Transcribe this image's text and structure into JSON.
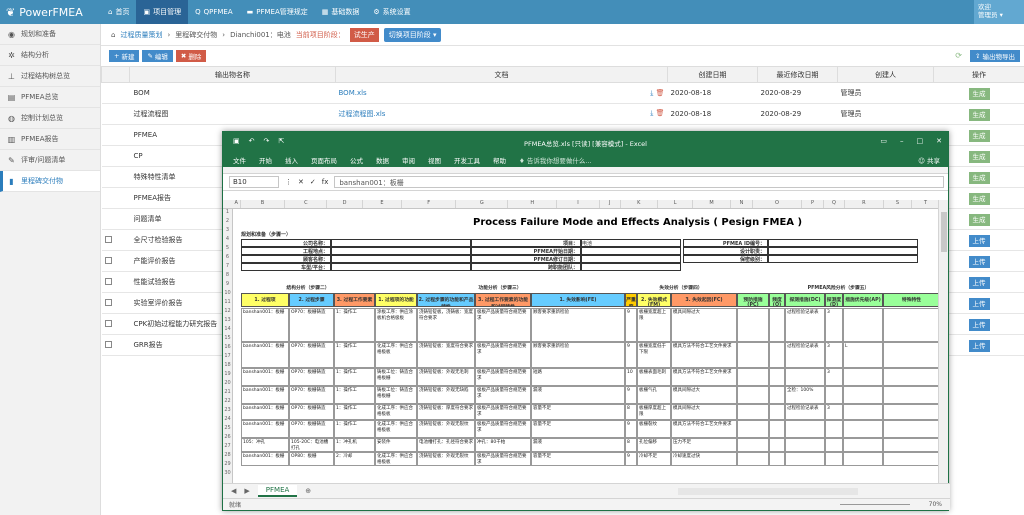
{
  "app": {
    "title": "PowerFMEA",
    "user_line1": "欢迎",
    "user_line2": "管理员"
  },
  "nav": [
    {
      "label": "首页",
      "icon": "home-icon"
    },
    {
      "label": "项目管理",
      "icon": "briefcase-icon"
    },
    {
      "label": "QPFMEA",
      "icon": "q-icon"
    },
    {
      "label": "PFMEA管理规定",
      "icon": "folder-icon"
    },
    {
      "label": "基础数据",
      "icon": "grid-icon"
    },
    {
      "label": "系统设置",
      "icon": "gear-icon"
    }
  ],
  "sidebar": [
    {
      "label": "规划和准备"
    },
    {
      "label": "结构分析"
    },
    {
      "label": "过程结构树总览"
    },
    {
      "label": "PFMEA总览"
    },
    {
      "label": "控制计划总览"
    },
    {
      "label": "PFMEA报告"
    },
    {
      "label": "评审/问题清单"
    },
    {
      "label": "里程碑交付物"
    }
  ],
  "breadcrumb": {
    "items": [
      "过程质量策划",
      "里程碑交付物",
      "Dianchi001：电池"
    ],
    "stage_label": "当前项目阶段：",
    "stage_value": "试生产",
    "switch_label": "切换项目阶段"
  },
  "toolbar": {
    "new": "新建",
    "edit": "编辑",
    "delete": "删除",
    "export": "输出物导出"
  },
  "table": {
    "headers": [
      "输出物名称",
      "文档",
      "创建日期",
      "最近修改日期",
      "创建人",
      "操作"
    ],
    "rows": [
      {
        "name": "BOM",
        "doc": "BOM.xls",
        "created": "2020-08-18",
        "modified": "2020-08-29",
        "creator": "管理员",
        "action": "生成",
        "checkbox": false
      },
      {
        "name": "过程流程图",
        "doc": "过程流程图.xls",
        "created": "2020-08-18",
        "modified": "2020-08-29",
        "creator": "管理员",
        "action": "生成",
        "checkbox": false
      },
      {
        "name": "PFMEA",
        "doc": "",
        "created": "",
        "modified": "",
        "creator": "",
        "action": "生成",
        "checkbox": false
      },
      {
        "name": "CP",
        "doc": "",
        "created": "",
        "modified": "",
        "creator": "",
        "action": "生成",
        "checkbox": false
      },
      {
        "name": "特殊特性清单",
        "doc": "",
        "created": "",
        "modified": "",
        "creator": "",
        "action": "生成",
        "checkbox": false
      },
      {
        "name": "PFMEA报告",
        "doc": "",
        "created": "",
        "modified": "",
        "creator": "",
        "action": "生成",
        "checkbox": false
      },
      {
        "name": "问题清单",
        "doc": "",
        "created": "",
        "modified": "",
        "creator": "",
        "action": "生成",
        "checkbox": false
      },
      {
        "name": "全尺寸检验报告",
        "doc": "",
        "created": "",
        "modified": "",
        "creator": "",
        "action": "上传",
        "checkbox": true
      },
      {
        "name": "产能评价报告",
        "doc": "",
        "created": "",
        "modified": "",
        "creator": "",
        "action": "上传",
        "checkbox": true
      },
      {
        "name": "性能试验报告",
        "doc": "",
        "created": "",
        "modified": "",
        "creator": "",
        "action": "上传",
        "checkbox": true
      },
      {
        "name": "实验室评价报告",
        "doc": "",
        "created": "",
        "modified": "",
        "creator": "",
        "action": "上传",
        "checkbox": true
      },
      {
        "name": "CPK初始过程能力研究报告",
        "doc": "",
        "created": "",
        "modified": "",
        "creator": "",
        "action": "上传",
        "checkbox": true
      },
      {
        "name": "GRR报告",
        "doc": "",
        "created": "",
        "modified": "",
        "creator": "",
        "action": "上传",
        "checkbox": true
      }
    ]
  },
  "excel": {
    "title": "PFMEA总览.xls  [只读]  [兼容模式] - Excel",
    "menu": [
      "文件",
      "开始",
      "插入",
      "页面布局",
      "公式",
      "数据",
      "审阅",
      "视图",
      "开发工具",
      "帮助"
    ],
    "tell": "告诉我你想要做什么...",
    "share": "共享",
    "namebox": "B10",
    "formula": "banshan001：板栅",
    "sheet_title": "Process Failure Mode and Effects Analysis ( Pesign FMEA )",
    "plan_label": "规划和准备（步骤一）",
    "form_labels": [
      "公司名称：",
      "工程地点：",
      "顾客名称：",
      "车型/平台：",
      "项目：",
      "PFMEA开始日期：",
      "PFMEA修订日期：",
      "跨职能团队：",
      "PFMEA ID编号：",
      "设计职责：",
      "保密级别："
    ],
    "form_values": [
      "电池"
    ],
    "section_heads": [
      "结构分析（步骤二）",
      "功能分析（步骤三）",
      "失效分析（步骤四）",
      "PFMEA风险分析（步骤五）"
    ],
    "col_heads": [
      "1. 过程项",
      "2. 过程步骤",
      "3. 过程工作要素",
      "1. 过程项的功能",
      "2. 过程步骤的功能和产品特性",
      "3. 过程工作要素的功能和过程特性",
      "1. 失效影响(FE)",
      "严重度(S)",
      "2. 失效模式(FM)",
      "3. 失效起因(FC)",
      "预防措施(PC)",
      "频度(O)",
      "探测措施(DC)",
      "探测度(D)",
      "措施优先级(AP)",
      "特殊特性"
    ],
    "rows": [
      [
        "banshan001：板栅",
        "OP70：板栅铸造",
        "1：操作工",
        "涂板工序：供应涂板机合格极板",
        "浇铸铅锭板，浇铸板：宽度符合要求",
        "极板产品质量符合规范要求",
        "顾客要求重新检验",
        "9",
        "板栅宽度超上限",
        "模具间隙过大",
        "过程检验记录表",
        "3",
        "",
        "",
        ""
      ],
      [
        "banshan001：板栅",
        "OP70：板栅铸造",
        "1：操作工",
        "化成工序：供应合格极板",
        "浇铸铅锭板：宽度符合要求",
        "极板产品质量符合规范要求",
        "顾客要求重新检验",
        "9",
        "板栅宽度低于下限",
        "模具方法不符合工艺文件要求",
        "过程检验记录表",
        "3",
        "L",
        "",
        ""
      ],
      [
        "banshan001：板栅",
        "OP70：板栅铸造",
        "1：操作工",
        "铸板工位：铸造合格板栅",
        "浇铸铅锭板：外观无毛刺",
        "极板产品质量符合规范要求",
        "短路",
        "10",
        "板栅表面毛刺",
        "模具方法不符合工艺文件要求",
        "",
        "3",
        "",
        "",
        ""
      ],
      [
        "banshan001：板栅",
        "OP70：板栅铸造",
        "1：操作工",
        "铸板工位：铸造合格板栅",
        "浇铸铅锭板：外观无缺陷",
        "极板产品质量符合规范要求",
        "漏液",
        "9",
        "板栅气孔",
        "模具间隙过大",
        "全检：100%",
        "",
        "",
        "",
        ""
      ],
      [
        "banshan001：板栅",
        "OP70：板栅铸造",
        "1：操作工",
        "化成工序：供应合格极板",
        "浇铸铅锭板：厚度符合要求",
        "极板产品质量符合规范要求",
        "容量不足",
        "8",
        "板栅厚度超上限",
        "模具间隙过大",
        "过程检验记录表",
        "3",
        "",
        "",
        ""
      ],
      [
        "banshan001：板栅",
        "OP70：板栅铸造",
        "1：操作工",
        "化成工序：供应合格极板",
        "浇铸铅锭板：外观无裂纹",
        "极板产品质量符合规范要求",
        "容量不足",
        "9",
        "板栅裂纹",
        "模具方法不符合工艺文件要求",
        "",
        "",
        "",
        "",
        ""
      ],
      [
        "105：冲孔",
        "105-20C：电池槽打孔",
        "1：冲孔机",
        "安装件",
        "电池槽打孔：孔径符合要求",
        "冲孔：80千帕",
        "漏液",
        "8",
        "孔位偏移",
        "压力不足",
        "",
        "",
        "",
        "",
        ""
      ],
      [
        "banshan001：板栅",
        "OP80：板栅",
        "2：冷却",
        "化成工序：供应合格极板",
        "浇铸铅锭板：外观无裂纹",
        "极板产品质量符合规范要求",
        "容量不足",
        "9",
        "冷却不足",
        "冷却速度过快",
        "",
        "",
        "",
        "",
        ""
      ]
    ],
    "sheet_tab": "PFMEA",
    "status_left": "就绪",
    "zoom": "70%"
  },
  "colors": {
    "topbar": "#438eb9",
    "excel_green": "#217346",
    "header_yellow": "#ffff66",
    "header_blue": "#66ccff",
    "header_green": "#99ff99",
    "header_red": "#ff9966"
  }
}
